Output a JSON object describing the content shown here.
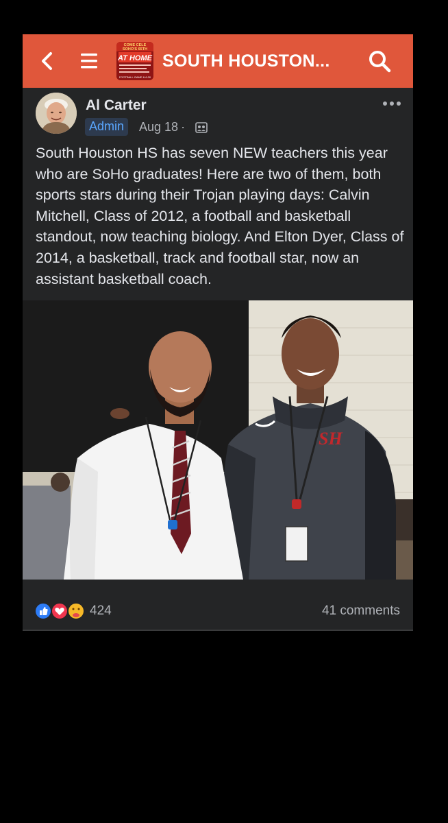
{
  "header": {
    "group_title": "SOUTH HOUSTON...",
    "group_thumb_text": {
      "line1": "COME CELE",
      "line2": "SOHO'S 65TH",
      "line3": "AT HOME",
      "line4": "FOOTBALL GAME & 6:30"
    },
    "icons": {
      "back": "chevron-left-icon",
      "menu": "hamburger-menu-icon",
      "search": "search-icon"
    },
    "background_color": "#e0573b"
  },
  "post": {
    "author": "Al Carter",
    "role_badge": "Admin",
    "date": "Aug 18",
    "separator": "·",
    "audience_icon": "group-members-icon",
    "more_icon": "more-options-icon",
    "body": "South Houston HS has seven NEW teachers this year who are SoHo graduates! Here are two of them, both sports stars during their Trojan playing days: Calvin Mitchell, Class of 2012, a football and basketball standout, now teaching biology. And Elton Dyer, Class of 2014, a basketball, track and football star, now an assistant basketball coach.",
    "photo_shirt_logo": "SH"
  },
  "footer": {
    "reaction_icons": [
      "like-icon",
      "love-icon",
      "care-icon"
    ],
    "reaction_count": "424",
    "comments": "41 comments"
  },
  "colors": {
    "card_background": "#242526",
    "primary_text": "#e4e6eb",
    "secondary_text": "#b0b3b8",
    "badge_text": "#5aa7ff",
    "like_blue": "#2d7cf6",
    "love_red": "#f0364f",
    "care_yellow": "#f7b928"
  }
}
